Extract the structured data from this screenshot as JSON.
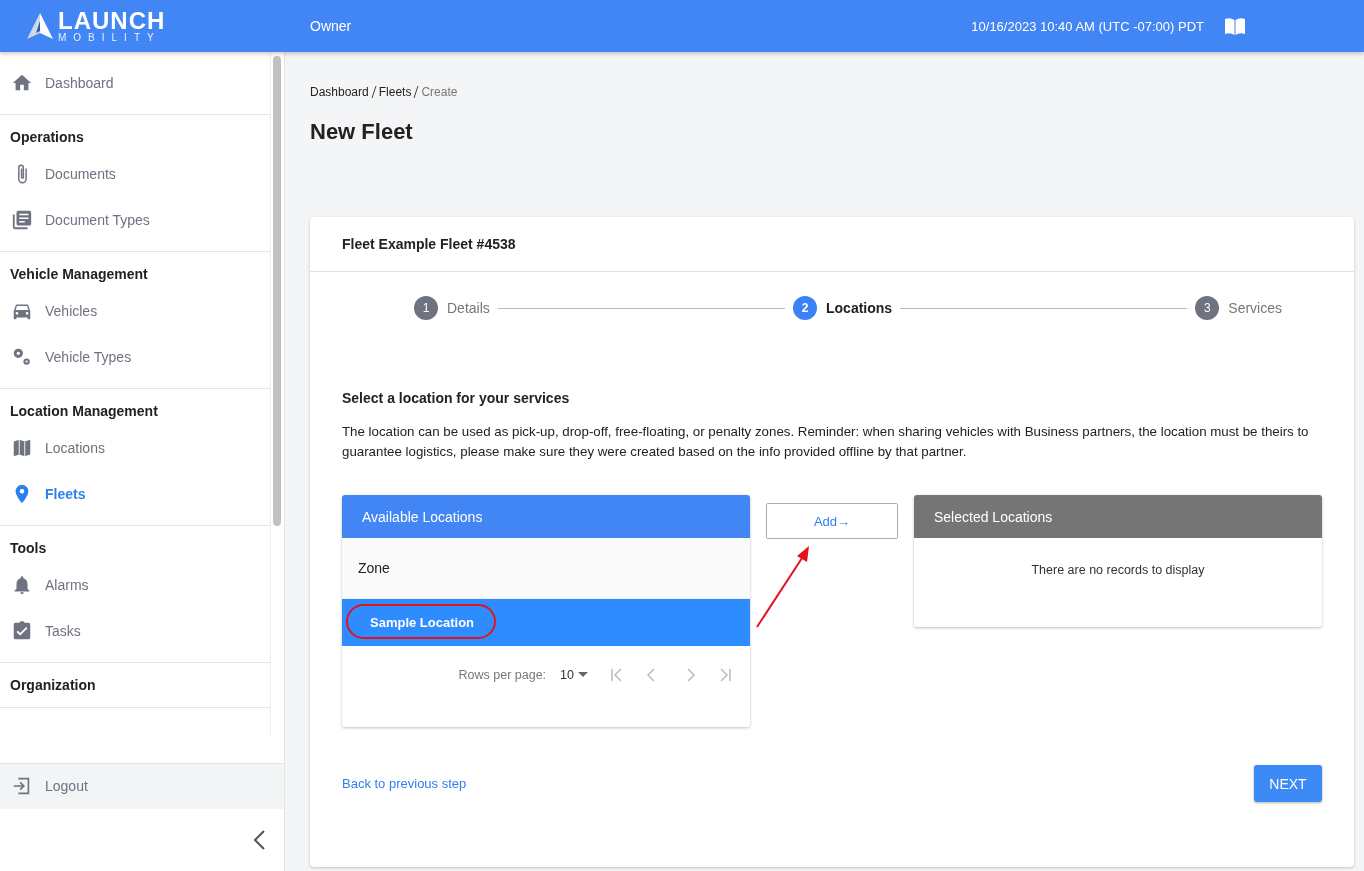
{
  "header": {
    "logo_main": "LAUNCH",
    "logo_sub": "MOBILITY",
    "role": "Owner",
    "datetime": "10/16/2023 10:40 AM (UTC -07:00) PDT"
  },
  "sidebar": {
    "groups": [
      {
        "items": [
          {
            "label": "Dashboard",
            "selected": false
          }
        ]
      },
      {
        "heading": "Operations",
        "items": [
          {
            "label": "Documents",
            "selected": false
          },
          {
            "label": "Document Types",
            "selected": false
          }
        ]
      },
      {
        "heading": "Vehicle Management",
        "items": [
          {
            "label": "Vehicles",
            "selected": false
          },
          {
            "label": "Vehicle Types",
            "selected": false
          }
        ]
      },
      {
        "heading": "Location Management",
        "items": [
          {
            "label": "Locations",
            "selected": false
          },
          {
            "label": "Fleets",
            "selected": true
          }
        ]
      },
      {
        "heading": "Tools",
        "items": [
          {
            "label": "Alarms",
            "selected": false
          },
          {
            "label": "Tasks",
            "selected": false
          }
        ]
      },
      {
        "heading": "Organization"
      }
    ],
    "logout": "Logout"
  },
  "breadcrumbs": [
    "Dashboard",
    "Fleets",
    "Create"
  ],
  "page_title": "New Fleet",
  "card": {
    "title": "Fleet Example Fleet #4538",
    "steps": [
      {
        "number": "1",
        "label": "Details",
        "selected": false
      },
      {
        "number": "2",
        "label": "Locations",
        "selected": true
      },
      {
        "number": "3",
        "label": "Services",
        "selected": false
      }
    ],
    "section_title": "Select a location for your services",
    "description": "The location can be used as pick-up, drop-off, free-floating, or penalty zones. Reminder: when sharing vehicles with Business partners, the location must be theirs to guarantee logistics, please make sure they were created based on the info provided offline by that partner.",
    "available": {
      "title": "Available Locations",
      "columns": [
        "Zone"
      ],
      "rows": [
        {
          "name": "Sample Location",
          "selected": true
        }
      ],
      "rows_per_page_label": "Rows per page:",
      "rows_per_page": "10"
    },
    "add_button": "Add→",
    "selected_panel": {
      "title": "Selected Locations",
      "empty_text": "There are no records to display"
    },
    "back_link": "Back to previous step",
    "next_button": "NEXT"
  }
}
